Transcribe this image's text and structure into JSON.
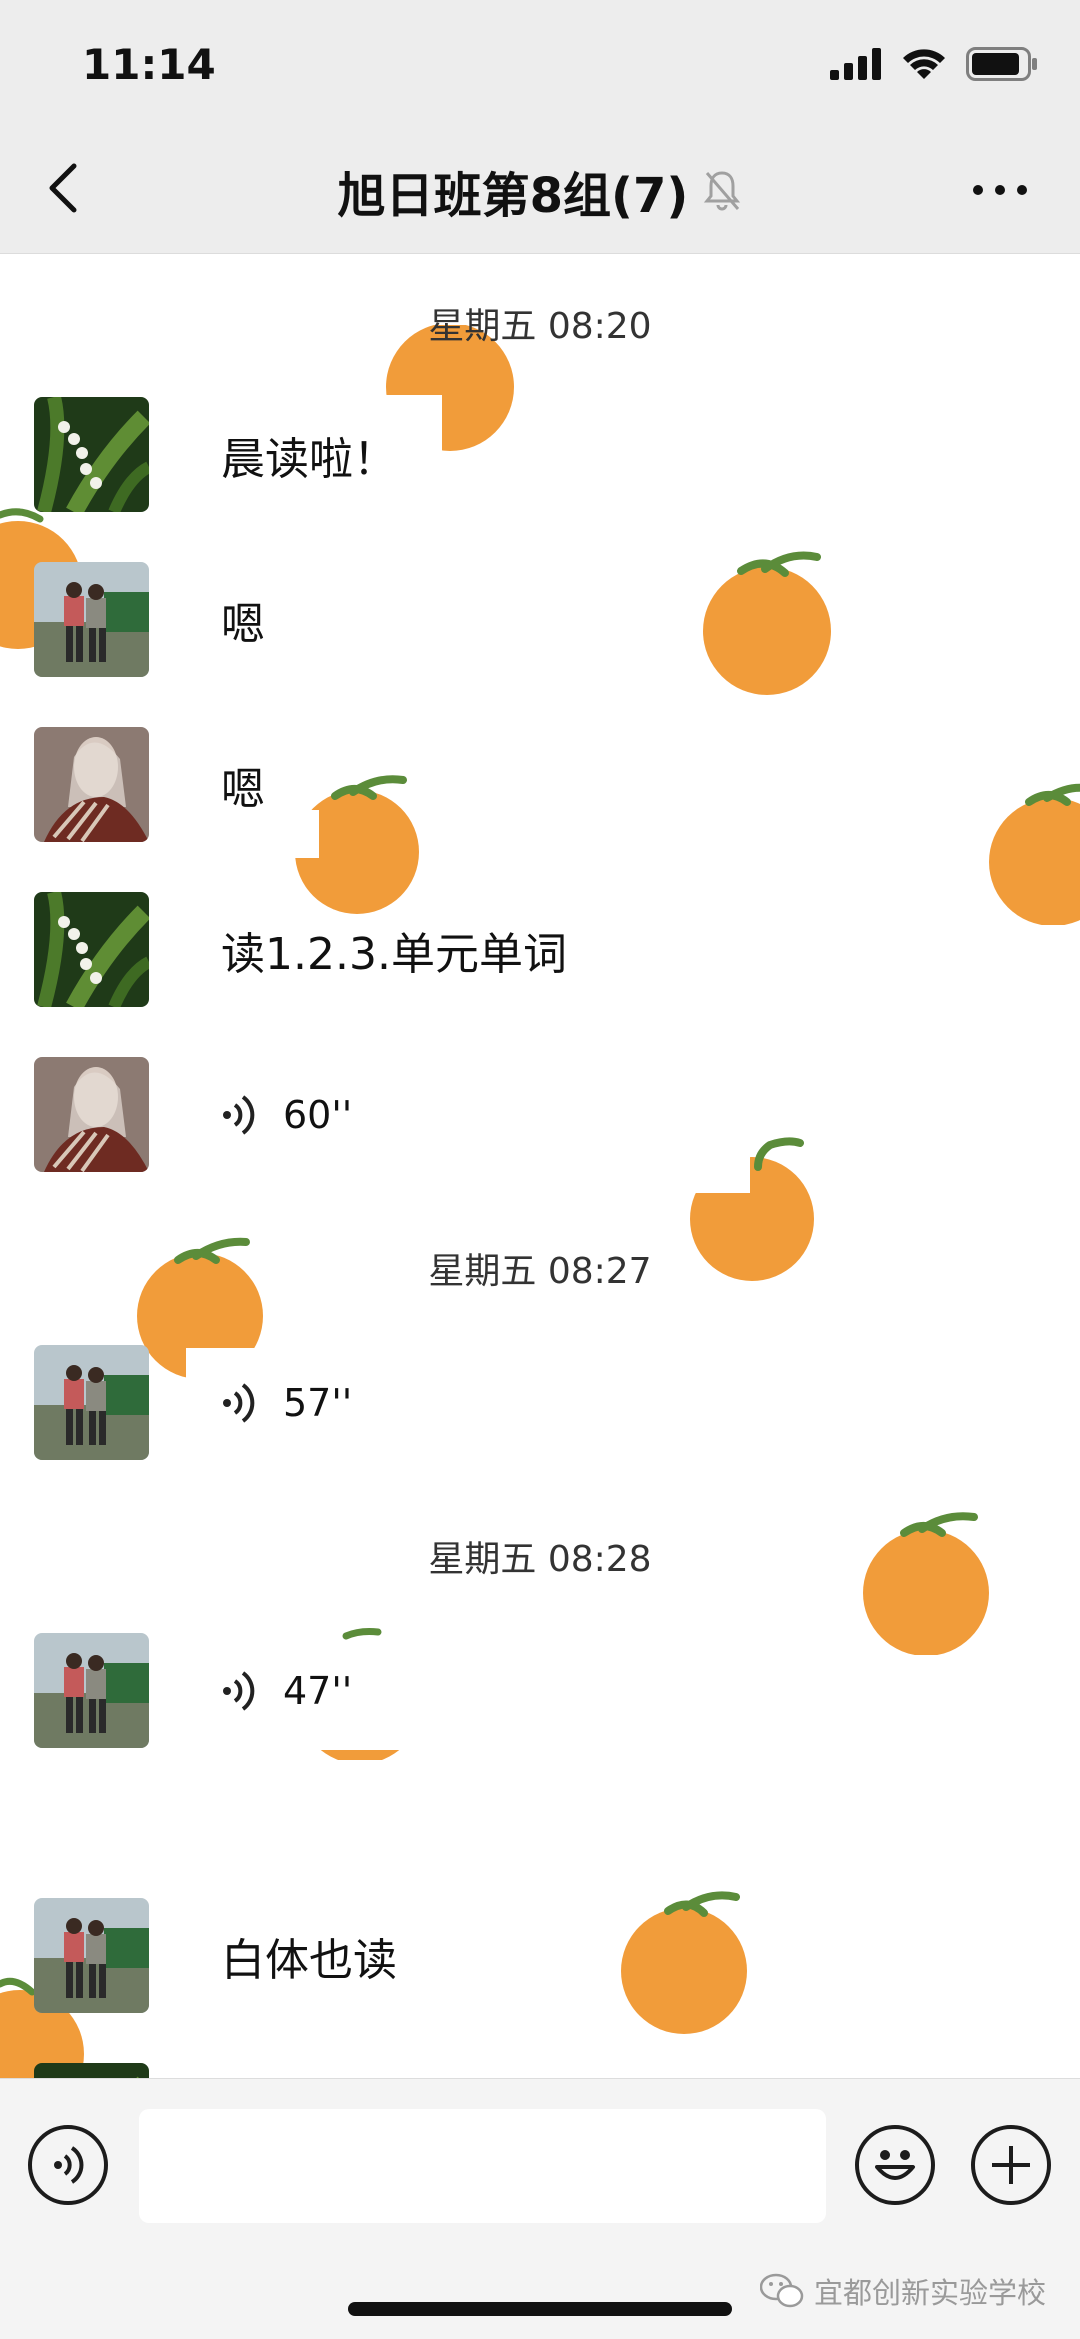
{
  "status_bar": {
    "time": "11:14"
  },
  "nav": {
    "title": "旭日班第8组(7)"
  },
  "messages": [
    {
      "type": "timestamp",
      "text": "星期五 08:20"
    },
    {
      "type": "text",
      "avatar": "lily-of-the-valley",
      "text": "晨读啦！"
    },
    {
      "type": "text",
      "avatar": "two-people-photo",
      "text": "嗯"
    },
    {
      "type": "text",
      "avatar": "illustrated-figure",
      "text": "嗯"
    },
    {
      "type": "text",
      "avatar": "lily-of-the-valley",
      "text": "读1.2.3.单元单词"
    },
    {
      "type": "voice",
      "avatar": "illustrated-figure",
      "duration": "60''"
    },
    {
      "type": "timestamp",
      "text": "星期五 08:27"
    },
    {
      "type": "voice",
      "avatar": "two-people-photo",
      "duration": "57''"
    },
    {
      "type": "timestamp",
      "text": "星期五 08:28"
    },
    {
      "type": "voice",
      "avatar": "two-people-photo",
      "duration": "47''"
    },
    {
      "type": "text",
      "avatar": "two-people-photo",
      "text": "白体也读"
    }
  ],
  "input_bar": {
    "placeholder": "",
    "left_icon": "voice-input-icon",
    "right_icons": [
      "emoji-icon",
      "plus-icon"
    ]
  },
  "watermark": {
    "text": "宜都创新实验学校"
  },
  "colors": {
    "orange": "#f19c3a",
    "stem": "#5b8c3a",
    "nav_bg": "#ededed",
    "input_bg": "#f4f4f4"
  }
}
